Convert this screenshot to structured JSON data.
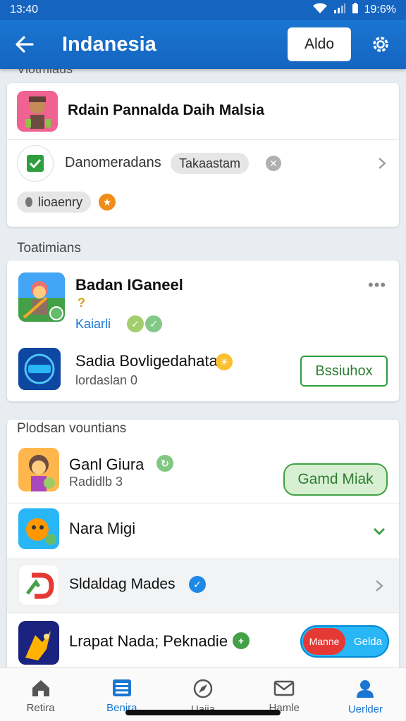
{
  "status_bar": {
    "time": "13:40",
    "battery_text": "19:6%"
  },
  "app_bar": {
    "title": "Indanesia",
    "add_label": "Aldo"
  },
  "top_cut_label": "Vlotmiaus",
  "card1": {
    "row1_title": "Rdain Pannalda Daih Malsia",
    "row2_text": "Danomeradans",
    "row2_chip": "Takaastam",
    "chip2_text": "lioaenry"
  },
  "section2": {
    "label": "Toatimians",
    "item1": {
      "title": "Badan IGaneel",
      "sub_mark": "?",
      "link": "Kaiarli"
    },
    "item2": {
      "title": "Sadia Bovligedahata",
      "sub": "lordaslan 0",
      "button": "Bssiuhox"
    }
  },
  "section3": {
    "label": "Plodsan vountians",
    "item1": {
      "title": "Ganl Giura",
      "sub": "Radidlb 3",
      "button": "Gamd Miak"
    },
    "item2": {
      "title": "Nara Migi"
    },
    "item3": {
      "title": "Sldaldag Mades"
    },
    "item4": {
      "title": "Lrapat Nada; Peknadie",
      "toggle_left": "Manne",
      "toggle_right": "Gelda"
    }
  },
  "bottom_nav": {
    "items": [
      {
        "label": "Retira",
        "icon": "home-icon"
      },
      {
        "label": "Benira",
        "icon": "list-icon"
      },
      {
        "label": "Uaiia",
        "icon": "compass-icon"
      },
      {
        "label": "Hamle",
        "icon": "mail-icon"
      },
      {
        "label": "Uerlder",
        "icon": "person-icon"
      }
    ]
  },
  "colors": {
    "primary": "#1565c0",
    "accent_green": "#2e9e3e",
    "active_nav": "#1976d2"
  }
}
